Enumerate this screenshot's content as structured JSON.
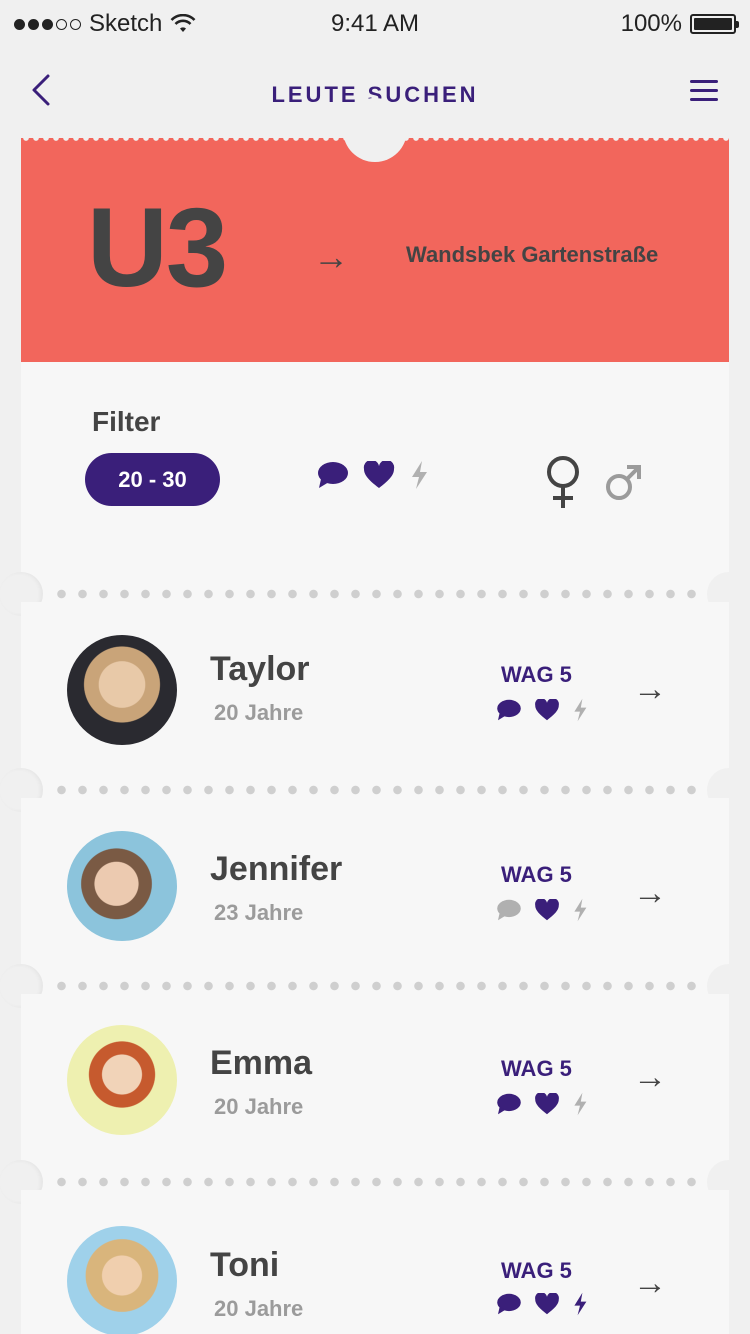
{
  "status": {
    "carrier": "Sketch",
    "time": "9:41 AM",
    "battery": "100%"
  },
  "nav": {
    "title": "LEUTE SUCHEN"
  },
  "ticket": {
    "line": "U3",
    "destination": "Wandsbek Gartenstraße"
  },
  "filter": {
    "label": "Filter",
    "age_range": "20 - 30"
  },
  "people": [
    {
      "name": "Taylor",
      "age": "20 Jahre",
      "wag": "WAG 5",
      "chat_active": true,
      "bolt_active": false
    },
    {
      "name": "Jennifer",
      "age": "23 Jahre",
      "wag": "WAG 5",
      "chat_active": false,
      "bolt_active": false
    },
    {
      "name": "Emma",
      "age": "20 Jahre",
      "wag": "WAG 5",
      "chat_active": true,
      "bolt_active": false
    },
    {
      "name": "Toni",
      "age": "20 Jahre",
      "wag": "WAG 5",
      "chat_active": true,
      "bolt_active": true
    }
  ],
  "colors": {
    "accent": "#3a1f7a",
    "ticket": "#f2665c",
    "muted": "#9b9b9b"
  }
}
